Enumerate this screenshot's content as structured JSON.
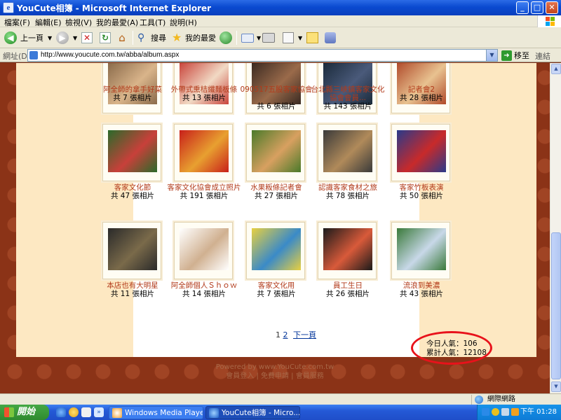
{
  "window": {
    "title": "YouCute相簿 - Microsoft Internet Explorer",
    "buttons": {
      "minimize": "_",
      "maximize": "□",
      "close": "✕"
    }
  },
  "menu": [
    "檔案(F)",
    "編輯(E)",
    "檢視(V)",
    "我的最愛(A)",
    "工具(T)",
    "說明(H)"
  ],
  "toolbar": {
    "back": "上一頁",
    "search": "搜尋",
    "favorites": "我的最愛"
  },
  "address": {
    "label": "網址(D)",
    "url": "http://www.youcute.com.tw/abba/album.aspx",
    "go": "移至",
    "links": "連結"
  },
  "albums": {
    "row1": [
      {
        "title": "阿全師的拿手好菜",
        "count": "共 7 張相片",
        "colors": [
          "#8a6a4a",
          "#d9b48a"
        ]
      },
      {
        "title": "外帶式熏桔纖麵板條",
        "count": "共 13 張相片",
        "colors": [
          "#c9443b",
          "#f1d9c4"
        ]
      },
      {
        "title": "090517五股客家協會",
        "count": "共 6 張相片",
        "colors": [
          "#3a2a22",
          "#9a6a4a"
        ]
      },
      {
        "title": "台北縣三峽鎮客家文化協會會員...",
        "count": "共 143 張相片",
        "colors": [
          "#1a2a3a",
          "#4a5a7a"
        ]
      },
      {
        "title": "記者會2",
        "count": "共 28 張相片",
        "colors": [
          "#b04a2a",
          "#e8c290"
        ]
      }
    ],
    "row2": [
      {
        "title": "客家文化節",
        "count": "共 47 張相片",
        "colors": [
          "#2a6a2a",
          "#c8403a"
        ]
      },
      {
        "title": "客家文化協會成立照片",
        "count": "共 191 張相片",
        "colors": [
          "#c8201a",
          "#e8a030"
        ]
      },
      {
        "title": "水果粄條記者會",
        "count": "共 27 張相片",
        "colors": [
          "#4a7a2a",
          "#d8a060"
        ]
      },
      {
        "title": "認識客家食材之旅",
        "count": "共 78 張相片",
        "colors": [
          "#3a3a3a",
          "#b08a5a"
        ]
      },
      {
        "title": "客家竹板表演",
        "count": "共 50 張相片",
        "colors": [
          "#2a3a8a",
          "#c82a2a"
        ]
      }
    ],
    "row3": [
      {
        "title": "本店也有大明星",
        "count": "共 11 張相片",
        "colors": [
          "#2a2a2a",
          "#7a6a4a"
        ]
      },
      {
        "title": "阿全師個人Ｓｈｏｗ",
        "count": "共 14 張相片",
        "colors": [
          "#ffffff",
          "#d0b090"
        ]
      },
      {
        "title": "客家文化用",
        "count": "共 7 張相片",
        "colors": [
          "#e8d040",
          "#3a8ac8"
        ]
      },
      {
        "title": "員工生日",
        "count": "共 26 張相片",
        "colors": [
          "#1a1a1a",
          "#d85a3a"
        ]
      },
      {
        "title": "流浪到美濃",
        "count": "共 43 張相片",
        "colors": [
          "#3a7a3a",
          "#c8d8e8"
        ]
      }
    ]
  },
  "pager": {
    "page1": "1",
    "page2": "2",
    "next": "下一頁"
  },
  "stats": {
    "today": "今日人氣：106",
    "total": "累計人氣：12108"
  },
  "footer": {
    "powered": "Powered by www.YouCute.com.tw",
    "links": "會員登入 | 免費申請 | 會員服務"
  },
  "statusbar": {
    "zone": "網際網路"
  },
  "taskbar": {
    "start": "開始",
    "tasks": [
      "Windows Media Player",
      "YouCute相簿 - Micro..."
    ],
    "clock": "下午 01:28"
  },
  "colors": {
    "accent": "#b23a1a",
    "background": "#8b3317",
    "stripe": "#fde8c2",
    "highlight": "#e8121b"
  }
}
